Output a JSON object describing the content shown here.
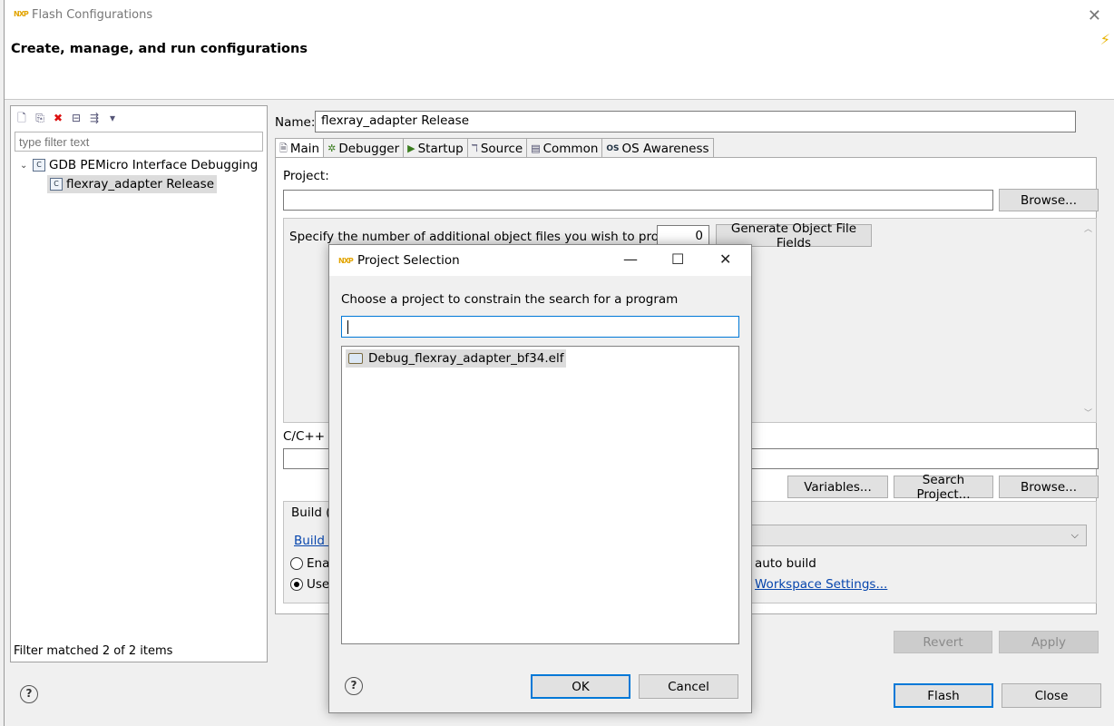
{
  "window": {
    "title": "Flash Configurations",
    "heading": "Create, manage, and run configurations"
  },
  "left_pane": {
    "filter_placeholder": "type filter text",
    "tree": [
      {
        "label": "GDB PEMicro Interface Debugging",
        "icon": "c-config-icon",
        "expanded": true
      },
      {
        "label": "flexray_adapter Release",
        "icon": "c-config-icon",
        "selected": true
      }
    ],
    "status": "Filter matched 2 of 2 items"
  },
  "right_pane": {
    "name_label": "Name:",
    "name_value": "flexray_adapter Release",
    "tabs": [
      {
        "label": "Main",
        "icon": "document-icon"
      },
      {
        "label": "Debugger",
        "icon": "bug-icon"
      },
      {
        "label": "Startup",
        "icon": "play-icon"
      },
      {
        "label": "Source",
        "icon": "source-icon"
      },
      {
        "label": "Common",
        "icon": "common-icon"
      },
      {
        "label": "OS Awareness",
        "icon": "os-icon"
      }
    ],
    "project_label": "Project:",
    "browse_label": "Browse...",
    "object_files_label": "Specify the number of additional object files you wish to program:",
    "object_files_count": "0",
    "generate_button": "Generate Object File Fields",
    "app_label_partial": "C/C++ Ap",
    "variables_button": "Variables...",
    "search_project_button": "Search Project...",
    "browse2_label": "Browse...",
    "build_group_partial": "Build (if",
    "build_link_partial": "Build C",
    "radio_enable_partial": "Enab",
    "radio_enable_suffix": "auto build",
    "radio_use_partial": "Use v",
    "workspace_link_partial": "Workspace Settings...",
    "revert_button": "Revert",
    "apply_button": "Apply",
    "flash_button": "Flash",
    "close_button": "Close"
  },
  "dialog": {
    "title": "Project Selection",
    "prompt": "Choose a project to constrain the search for a program",
    "filter_value": "",
    "items": [
      {
        "label": "Debug_flexray_adapter_bf34.elf",
        "icon": "folder-icon",
        "selected": true
      }
    ],
    "ok_button": "OK",
    "cancel_button": "Cancel"
  }
}
